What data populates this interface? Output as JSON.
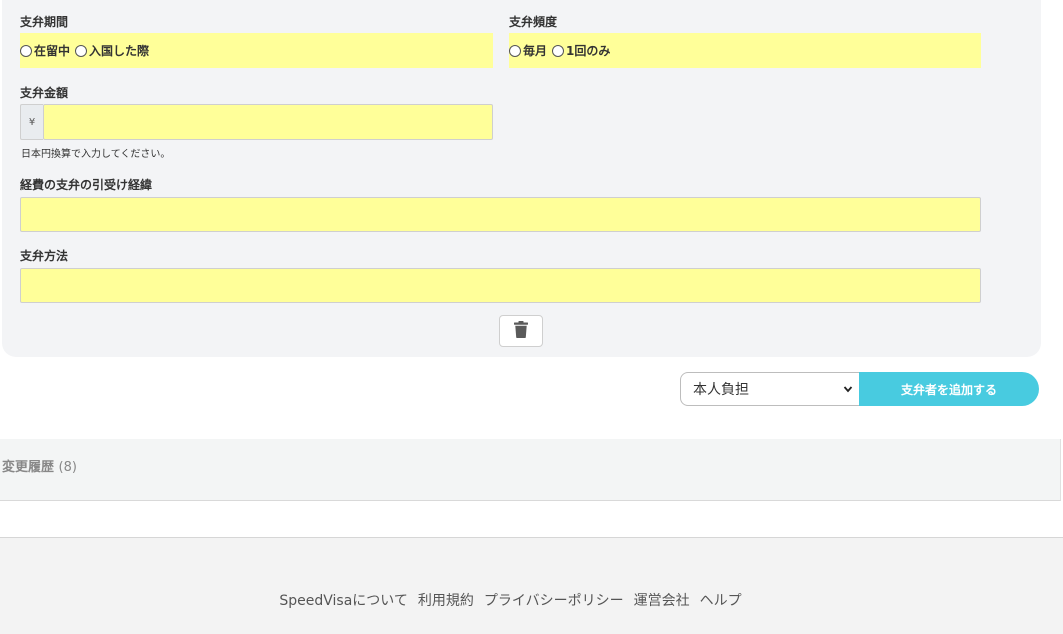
{
  "form": {
    "payment_period": {
      "label": "支弁期間",
      "options": [
        "在留中",
        "入国した際"
      ]
    },
    "payment_frequency": {
      "label": "支弁頻度",
      "options": [
        "毎月",
        "1回のみ"
      ]
    },
    "payment_amount": {
      "label": "支弁金額",
      "prefix": "¥",
      "value": "",
      "help": "日本円換算で入力してください。"
    },
    "expense_background": {
      "label": "経費の支弁の引受け経緯",
      "value": ""
    },
    "payment_method": {
      "label": "支弁方法",
      "value": ""
    },
    "delete_icon": "trash-icon"
  },
  "payer_actions": {
    "select_value": "本人負担",
    "add_label": "支弁者を追加する",
    "accent_color": "#48cbe0"
  },
  "history": {
    "title": "変更履歴",
    "count": "(8)"
  },
  "footer": {
    "links": [
      "SpeedVisaについて",
      "利用規約",
      "プライバシーポリシー",
      "運営会社",
      "ヘルプ"
    ]
  }
}
